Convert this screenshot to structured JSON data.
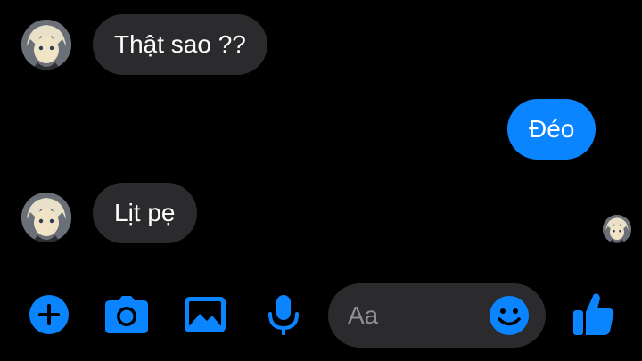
{
  "messages": [
    {
      "direction": "incoming",
      "text": "Thật sao ??"
    },
    {
      "direction": "outgoing",
      "text": "Đéo"
    },
    {
      "direction": "incoming",
      "text": "Lịt pẹ"
    }
  ],
  "composer": {
    "placeholder": "Aa"
  },
  "toolbar": {
    "icons": [
      "plus-icon",
      "camera-icon",
      "image-icon",
      "microphone-icon",
      "emoji-icon",
      "thumbs-up-icon"
    ]
  },
  "colors": {
    "background": "#000000",
    "accent": "#0a84ff",
    "incoming_bubble": "#2b2b2e",
    "text": "#ffffff",
    "placeholder": "#8e8e93"
  }
}
